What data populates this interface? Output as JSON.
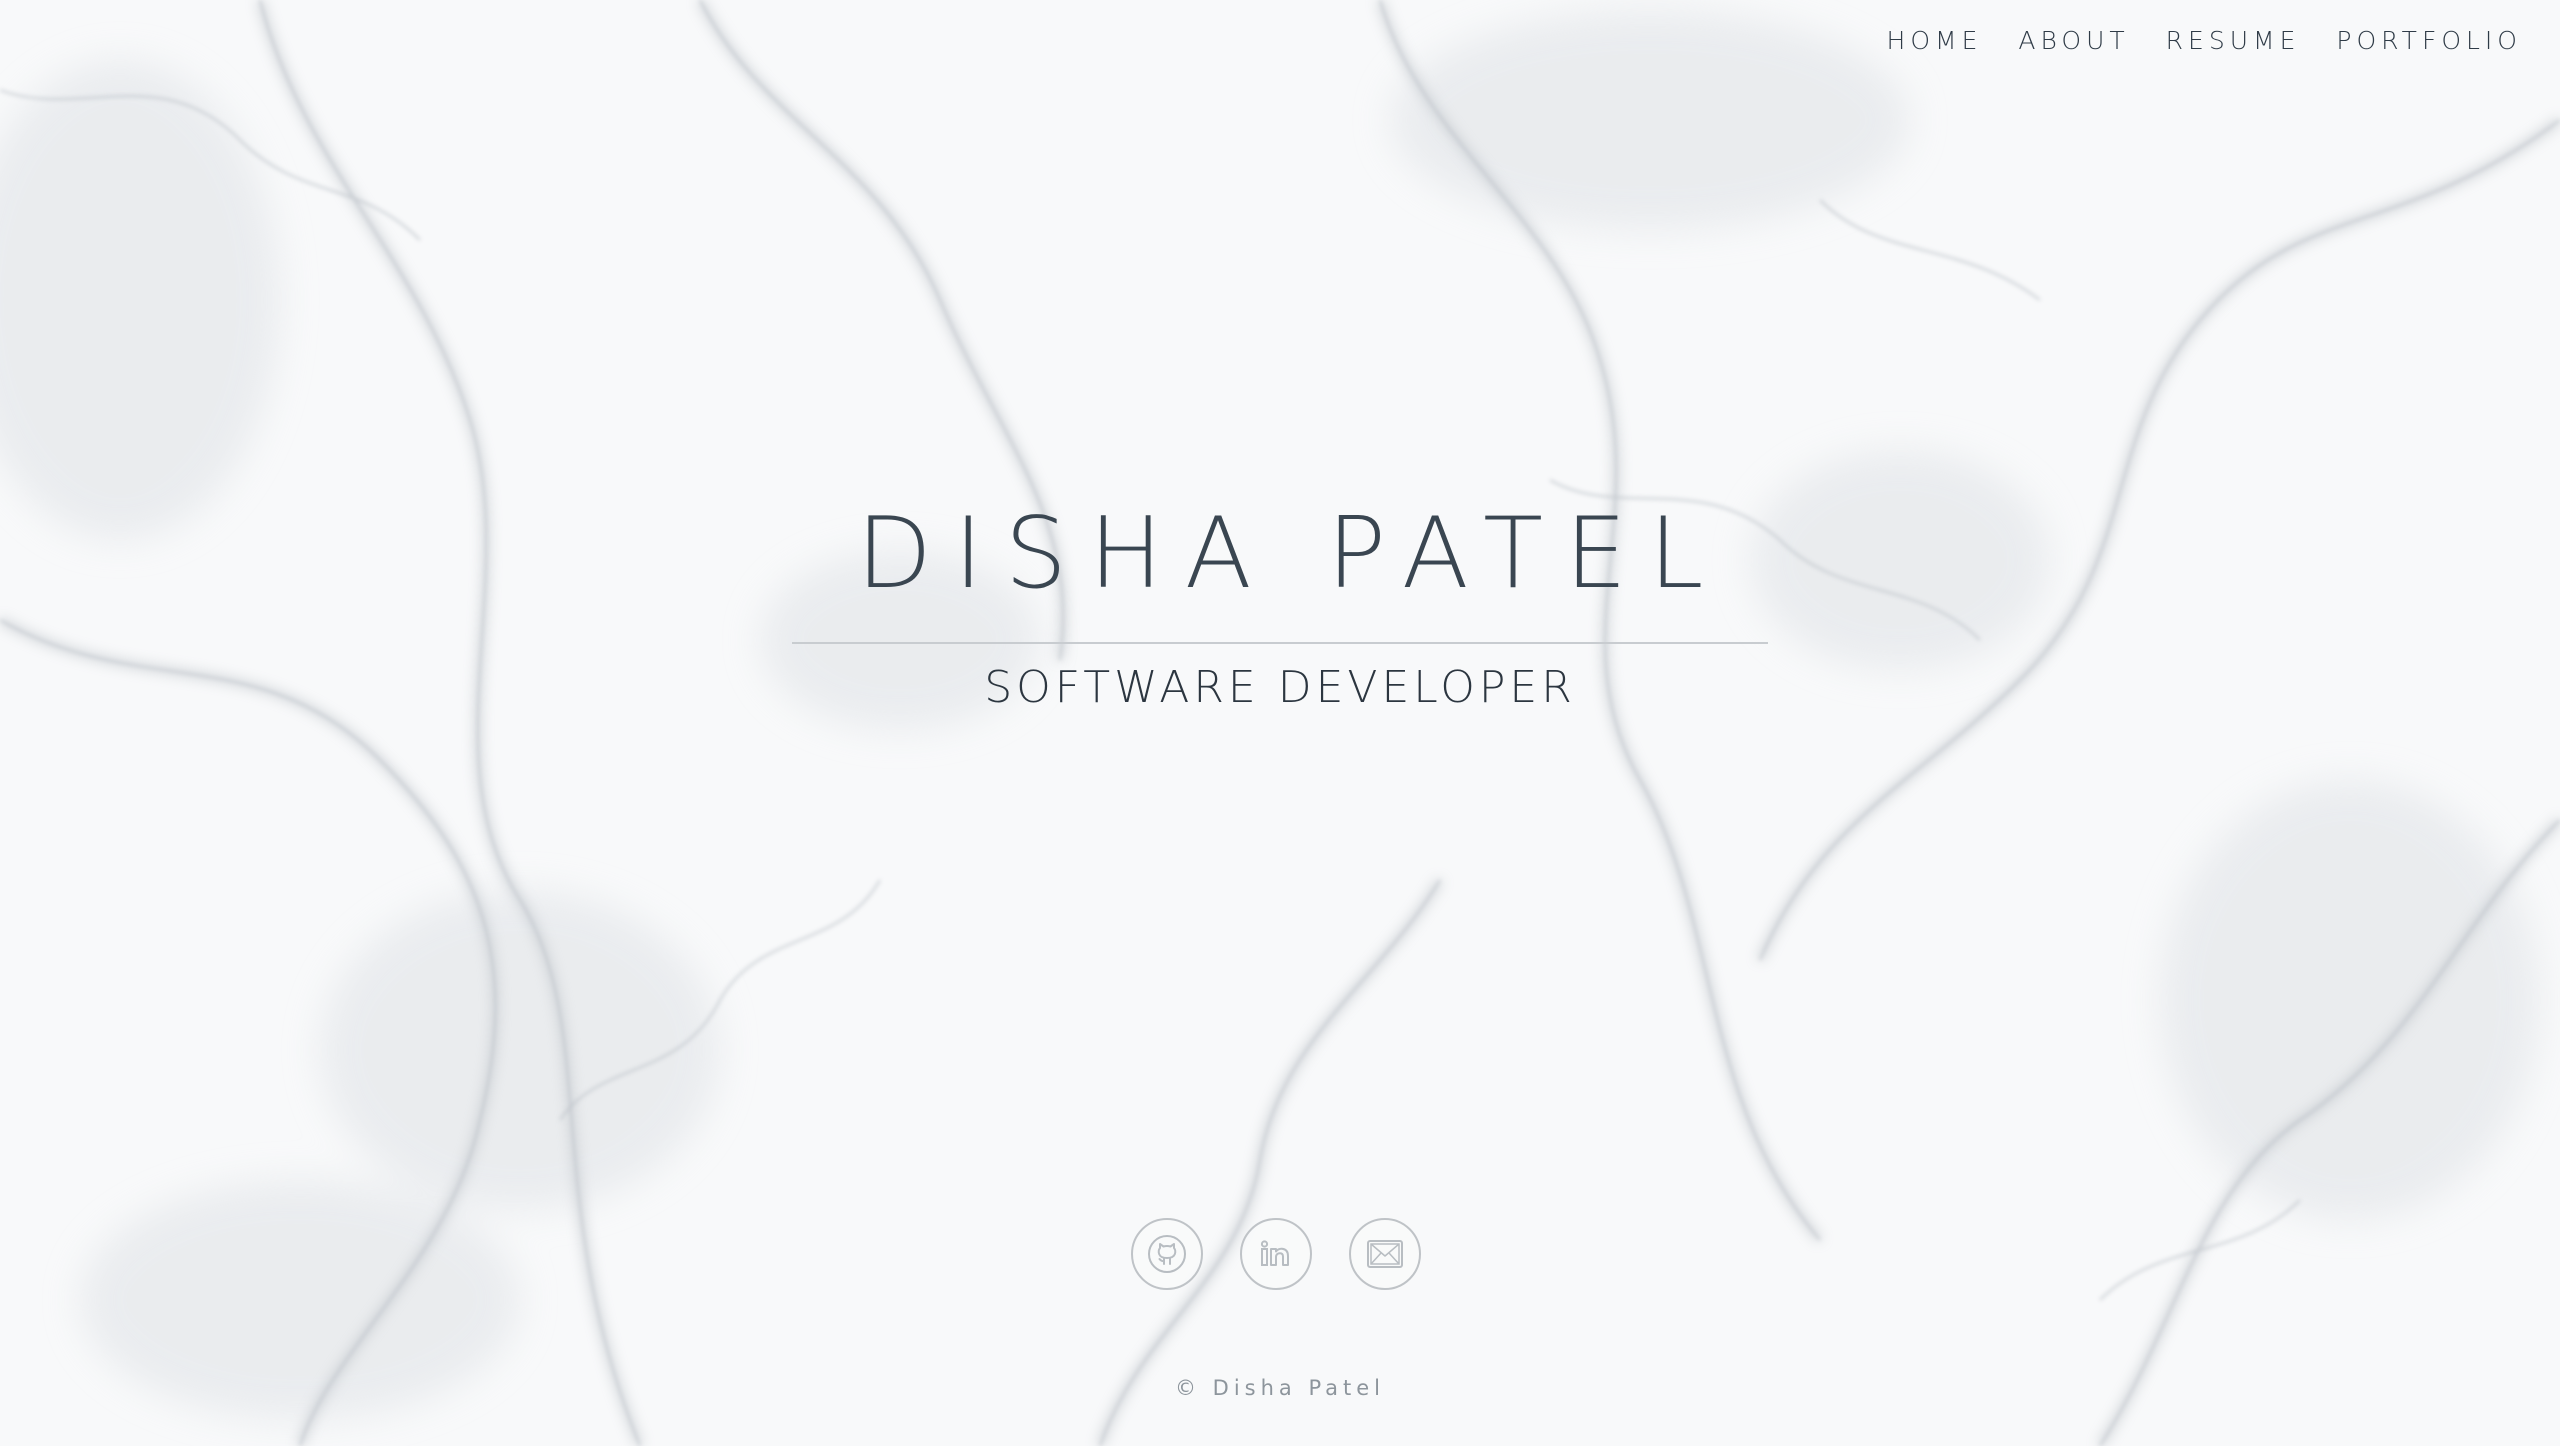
{
  "nav": {
    "items": [
      {
        "label": "HOME"
      },
      {
        "label": "ABOUT"
      },
      {
        "label": "RESUME"
      },
      {
        "label": "PORTFOLIO"
      }
    ]
  },
  "hero": {
    "name": "DISHA PATEL",
    "role": "SOFTWARE DEVELOPER"
  },
  "socials": [
    {
      "icon": "github-icon"
    },
    {
      "icon": "linkedin-icon"
    },
    {
      "icon": "email-icon"
    }
  ],
  "footer": {
    "copyright": "© Disha Patel"
  },
  "colors": {
    "text_dark": "#3a4651",
    "icon_outline": "#bfc3c7",
    "background": "#f7f8f9"
  }
}
